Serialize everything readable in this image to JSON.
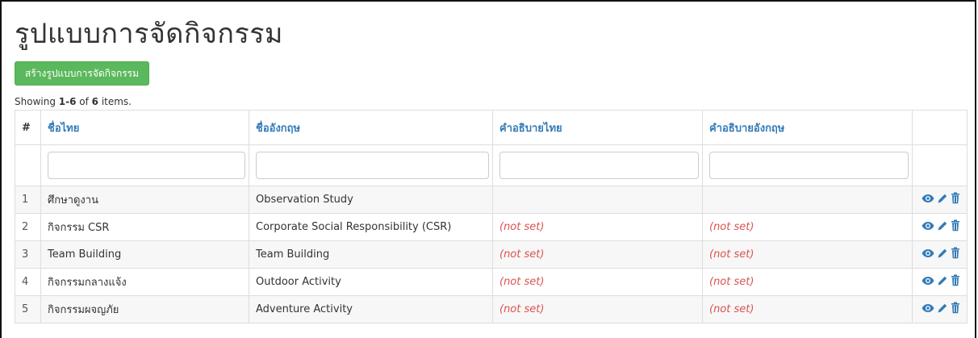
{
  "page": {
    "title": "รูปแบบการจัดกิจกรรม",
    "create_button": "สร้างรูปแบบการจัดกิจกรรม",
    "summary": {
      "prefix": "Showing ",
      "range": "1-6",
      "of": " of ",
      "total": "6",
      "suffix": " items."
    }
  },
  "table": {
    "columns": [
      "#",
      "ชื่อไทย",
      "ชื่ออังกฤษ",
      "คำอธิบายไทย",
      "คำอธิบายอังกฤษ"
    ],
    "filters": {
      "name_th": "",
      "name_en": "",
      "desc_th": "",
      "desc_en": ""
    },
    "rows": [
      {
        "num": "1",
        "name_th": "ศึกษาดูงาน",
        "name_en": "Observation Study",
        "desc_th": "",
        "desc_en": ""
      },
      {
        "num": "2",
        "name_th": "กิจกรรม CSR",
        "name_en": "Corporate Social Responsibility (CSR)",
        "desc_th": "(not set)",
        "desc_en": "(not set)"
      },
      {
        "num": "3",
        "name_th": "Team Building",
        "name_en": "Team Building",
        "desc_th": "(not set)",
        "desc_en": "(not set)"
      },
      {
        "num": "4",
        "name_th": "กิจกรรมกลางแจ้ง",
        "name_en": "Outdoor Activity",
        "desc_th": "(not set)",
        "desc_en": "(not set)"
      },
      {
        "num": "5",
        "name_th": "กิจกรรมผจญภัย",
        "name_en": "Adventure Activity",
        "desc_th": "(not set)",
        "desc_en": "(not set)"
      }
    ],
    "icons": {
      "view": "eye-icon",
      "edit": "pencil-icon",
      "delete": "trash-icon"
    },
    "icon_color": "#337ab7"
  }
}
